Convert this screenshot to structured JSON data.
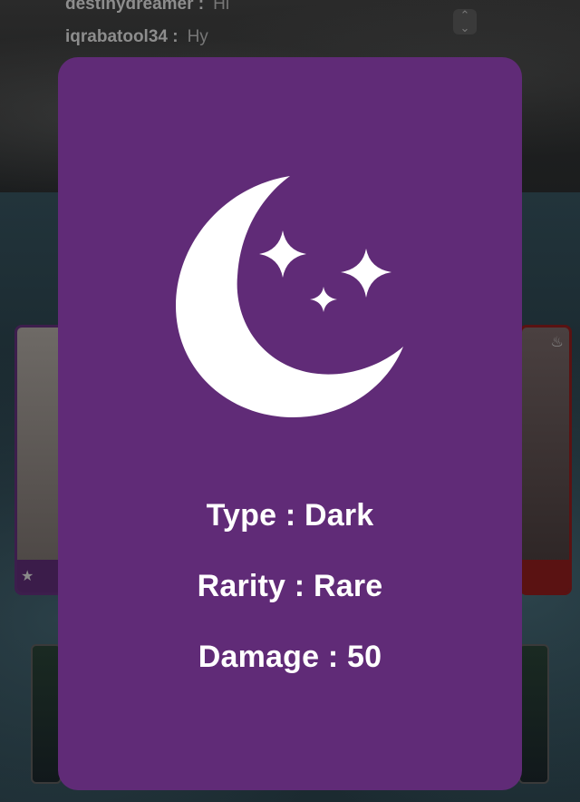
{
  "background": {
    "chat": [
      {
        "user": "destinydreamer :",
        "message": "Hi"
      },
      {
        "user": "iqrabatool34 :",
        "message": "Hy"
      }
    ]
  },
  "modal": {
    "icon": "crescent-moon-stars-icon",
    "background_color": "#602b77",
    "stats": {
      "type": "Type : Dark",
      "rarity": "Rarity : Rare",
      "damage": "Damage : 50"
    }
  }
}
